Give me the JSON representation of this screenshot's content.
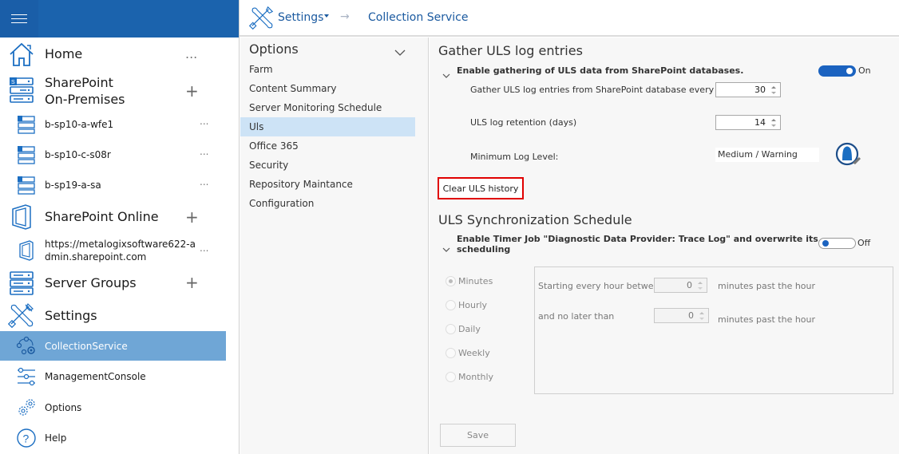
{
  "nav": {
    "menu_icon": "hamburger-icon",
    "items": [
      {
        "label": "Home",
        "icon": "home-icon",
        "action": "..."
      },
      {
        "label": "SharePoint",
        "label2": "On-Premises",
        "icon": "server-stack-icon",
        "action": "+"
      },
      {
        "label": "b-sp10-a-wfe1",
        "icon": "sharepoint-server-icon",
        "action": "..."
      },
      {
        "label": "b-sp10-c-s08r",
        "icon": "sharepoint-server-icon",
        "action": "..."
      },
      {
        "label": "b-sp19-a-sa",
        "icon": "sharepoint-server-icon",
        "action": "..."
      },
      {
        "label": "SharePoint Online",
        "icon": "office-icon",
        "action": "+"
      },
      {
        "label": "https://metalogixsoftware622-a",
        "label2": "dmin.sharepoint.com",
        "icon": "office-icon",
        "action": "..."
      },
      {
        "label": "Server Groups",
        "icon": "server-stack-icon",
        "action": "+"
      },
      {
        "label": "Settings",
        "icon": "tools-icon"
      },
      {
        "label": "CollectionService",
        "icon": "collection-service-icon",
        "selected": true
      },
      {
        "label": "ManagementConsole",
        "icon": "sliders-icon"
      },
      {
        "label": "Options",
        "icon": "gears-icon"
      },
      {
        "label": "Help",
        "icon": "help-icon"
      }
    ]
  },
  "breadcrumb": {
    "root": "Settings",
    "separator": "→",
    "current": "Collection Service"
  },
  "options_pane": {
    "title": "Options",
    "items": [
      "Farm",
      "Content Summary",
      "Server Monitoring Schedule",
      "Uls",
      "Office 365",
      "Security",
      "Repository Maintance",
      "Configuration"
    ],
    "selected": "Uls"
  },
  "gather": {
    "title": "Gather ULS log entries",
    "enable_label": "Enable gathering of ULS data from SharePoint databases.",
    "toggle_state": "On",
    "interval_label": "Gather ULS log entries from SharePoint database every (days)",
    "interval_value": "30",
    "retention_label": "ULS log retention (days)",
    "retention_value": "14",
    "min_level_label": "Minimum Log Level:",
    "min_level_value": "Medium / Warning",
    "clear_button": "Clear ULS history"
  },
  "sync": {
    "title": "ULS Synchronization Schedule",
    "enable_label_line1": "Enable Timer Job \"Diagnostic Data Provider: Trace Log\" and overwrite its",
    "enable_label_line2": "scheduling",
    "toggle_state": "Off",
    "frequencies": [
      "Minutes",
      "Hourly",
      "Daily",
      "Weekly",
      "Monthly"
    ],
    "selected_frequency": "Minutes",
    "start_label": "Starting every hour between",
    "start_value": "0",
    "start_suffix": "minutes past the hour",
    "end_label": "and no later than",
    "end_value": "0",
    "end_suffix": "minutes past the hour"
  },
  "save_button": "Save",
  "colors": {
    "brand_blue": "#1b63ad",
    "selected_nav": "#6fa6d6",
    "selected_option": "#cde3f6",
    "highlight_red": "#e00000"
  }
}
